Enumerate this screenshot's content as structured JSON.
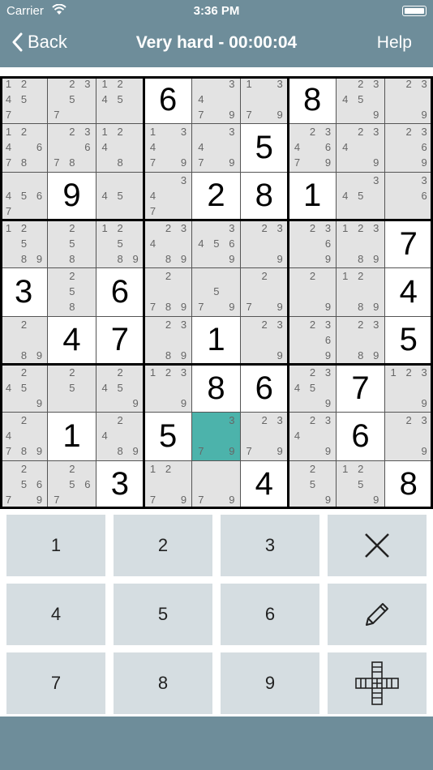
{
  "status_bar": {
    "carrier": "Carrier",
    "time": "3:36 PM"
  },
  "nav": {
    "back_label": "Back",
    "title": "Very hard - 00:00:04",
    "help_label": "Help"
  },
  "colors": {
    "header": "#6e8d9a",
    "selected_cell": "#4cb3ab",
    "shaded_cell": "#e3e3e3",
    "key_bg": "#d5dde1"
  },
  "selected_cell": {
    "row": 7,
    "col": 4
  },
  "board": [
    [
      {
        "n": [
          1,
          2,
          4,
          5,
          7
        ]
      },
      {
        "n": [
          2,
          3,
          5,
          7
        ]
      },
      {
        "n": [
          1,
          2,
          4,
          5
        ]
      },
      {
        "v": "6"
      },
      {
        "n": [
          3,
          4,
          7,
          9
        ]
      },
      {
        "n": [
          1,
          3,
          7,
          9
        ]
      },
      {
        "v": "8"
      },
      {
        "n": [
          2,
          3,
          4,
          5,
          9
        ]
      },
      {
        "n": [
          2,
          3,
          9
        ]
      }
    ],
    [
      {
        "n": [
          1,
          2,
          4,
          6,
          7,
          8
        ]
      },
      {
        "n": [
          2,
          3,
          6,
          7,
          8
        ]
      },
      {
        "n": [
          1,
          2,
          4,
          8
        ]
      },
      {
        "n": [
          1,
          3,
          4,
          7,
          9
        ]
      },
      {
        "n": [
          3,
          4,
          7,
          9
        ]
      },
      {
        "v": "5"
      },
      {
        "n": [
          2,
          3,
          4,
          6,
          7,
          9
        ]
      },
      {
        "n": [
          2,
          3,
          4,
          9
        ]
      },
      {
        "n": [
          2,
          3,
          6,
          9
        ]
      }
    ],
    [
      {
        "n": [
          4,
          5,
          6,
          7
        ]
      },
      {
        "v": "9"
      },
      {
        "n": [
          4,
          5
        ]
      },
      {
        "n": [
          3,
          4,
          7
        ]
      },
      {
        "v": "2"
      },
      {
        "v": "8"
      },
      {
        "v": "1"
      },
      {
        "n": [
          3,
          4,
          5
        ]
      },
      {
        "n": [
          3,
          6
        ]
      }
    ],
    [
      {
        "n": [
          1,
          2,
          5,
          8,
          9
        ]
      },
      {
        "n": [
          2,
          5,
          8
        ]
      },
      {
        "n": [
          1,
          2,
          5,
          8,
          9
        ]
      },
      {
        "n": [
          2,
          3,
          4,
          8,
          9
        ]
      },
      {
        "n": [
          3,
          4,
          5,
          6,
          9
        ]
      },
      {
        "n": [
          2,
          3,
          9
        ]
      },
      {
        "n": [
          2,
          3,
          6,
          9
        ]
      },
      {
        "n": [
          1,
          2,
          3,
          8,
          9
        ]
      },
      {
        "v": "7"
      }
    ],
    [
      {
        "v": "3"
      },
      {
        "n": [
          2,
          5,
          8
        ]
      },
      {
        "v": "6"
      },
      {
        "n": [
          2,
          7,
          8,
          9
        ]
      },
      {
        "n": [
          5,
          7,
          9
        ]
      },
      {
        "n": [
          2,
          7,
          9
        ]
      },
      {
        "n": [
          2,
          9
        ]
      },
      {
        "n": [
          1,
          2,
          8,
          9
        ]
      },
      {
        "v": "4"
      }
    ],
    [
      {
        "n": [
          2,
          8,
          9
        ]
      },
      {
        "v": "4"
      },
      {
        "v": "7"
      },
      {
        "n": [
          2,
          3,
          8,
          9
        ]
      },
      {
        "v": "1"
      },
      {
        "n": [
          2,
          3,
          9
        ]
      },
      {
        "n": [
          2,
          3,
          6,
          9
        ]
      },
      {
        "n": [
          2,
          3,
          8,
          9
        ]
      },
      {
        "v": "5"
      }
    ],
    [
      {
        "n": [
          2,
          4,
          5,
          9
        ]
      },
      {
        "n": [
          2,
          5
        ]
      },
      {
        "n": [
          2,
          4,
          5,
          9
        ]
      },
      {
        "n": [
          1,
          2,
          3,
          9
        ]
      },
      {
        "v": "8"
      },
      {
        "v": "6"
      },
      {
        "n": [
          2,
          3,
          4,
          5,
          9
        ]
      },
      {
        "v": "7"
      },
      {
        "n": [
          1,
          2,
          3,
          9
        ]
      }
    ],
    [
      {
        "n": [
          2,
          4,
          7,
          8,
          9
        ]
      },
      {
        "v": "1"
      },
      {
        "n": [
          2,
          4,
          8,
          9
        ]
      },
      {
        "v": "5"
      },
      {
        "n": [
          3,
          7,
          9
        ]
      },
      {
        "n": [
          2,
          3,
          7,
          9
        ]
      },
      {
        "n": [
          2,
          3,
          4,
          9
        ]
      },
      {
        "v": "6"
      },
      {
        "n": [
          2,
          3,
          9
        ]
      }
    ],
    [
      {
        "n": [
          2,
          5,
          6,
          7,
          9
        ]
      },
      {
        "n": [
          2,
          5,
          6,
          7
        ]
      },
      {
        "v": "3"
      },
      {
        "n": [
          1,
          2,
          7,
          9
        ]
      },
      {
        "n": [
          7,
          9
        ]
      },
      {
        "v": "4"
      },
      {
        "n": [
          2,
          5,
          9
        ]
      },
      {
        "n": [
          1,
          2,
          5,
          9
        ]
      },
      {
        "v": "8"
      }
    ]
  ],
  "keypad": {
    "digits": [
      "1",
      "2",
      "3",
      "4",
      "5",
      "6",
      "7",
      "8",
      "9"
    ],
    "actions": [
      {
        "name": "erase-button",
        "icon": "x-icon"
      },
      {
        "name": "pencil-button",
        "icon": "pencil-icon"
      },
      {
        "name": "hint-button",
        "icon": "cross-grid-icon"
      }
    ]
  }
}
